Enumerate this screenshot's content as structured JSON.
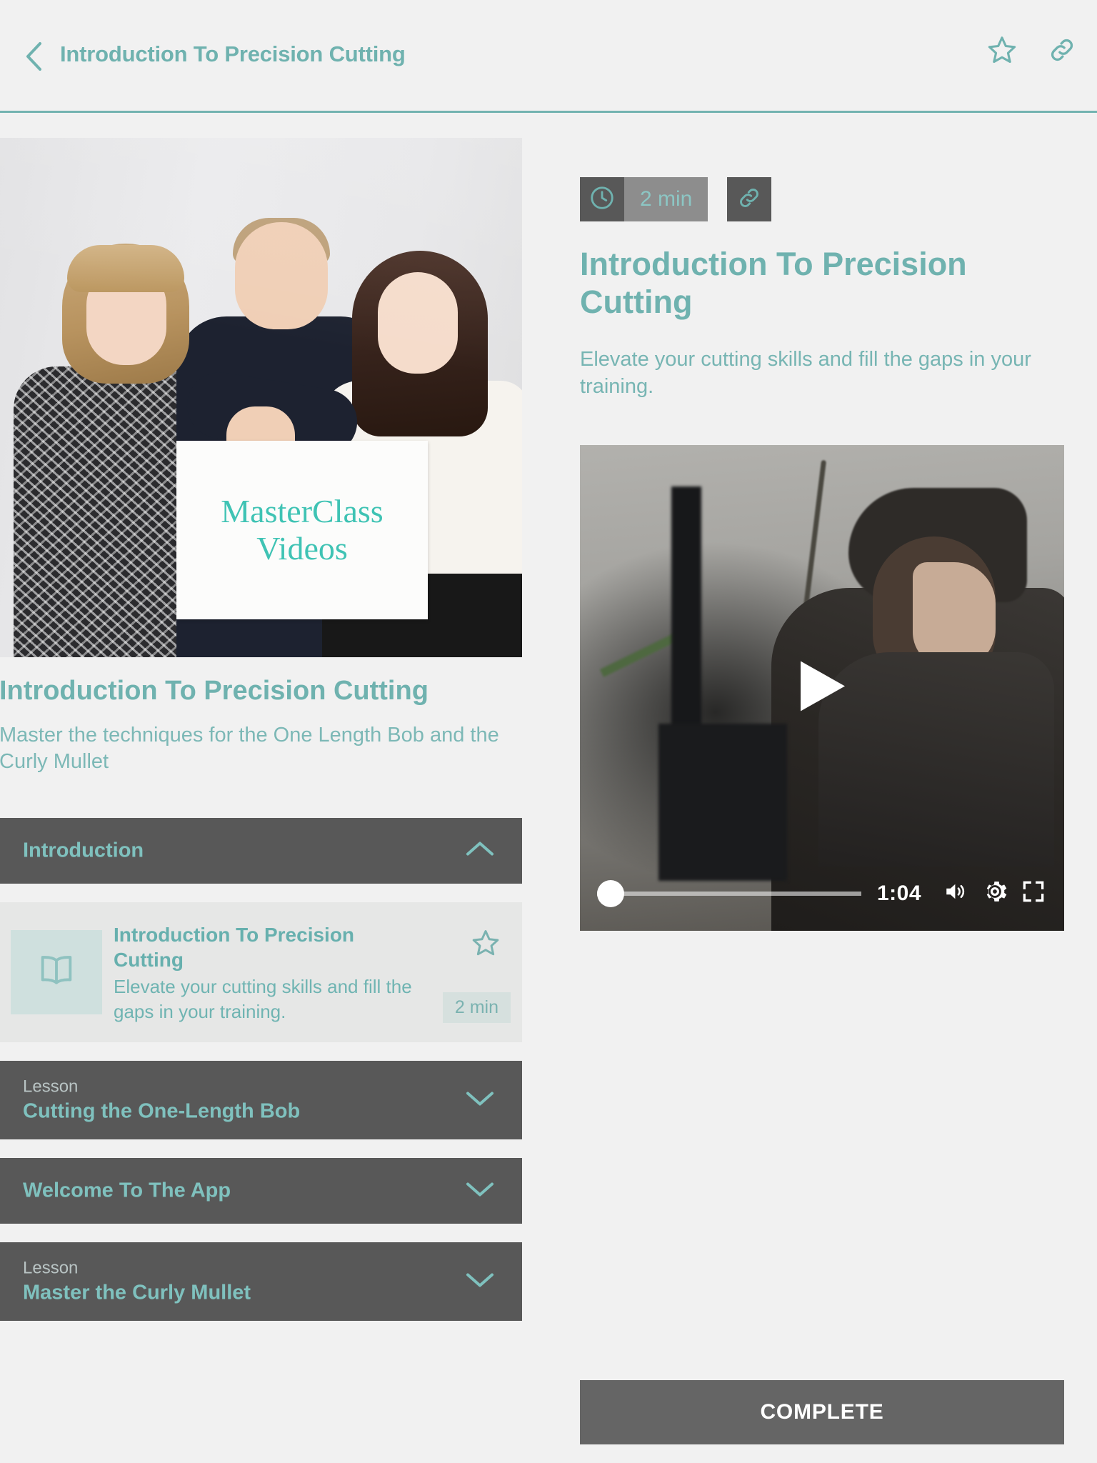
{
  "header": {
    "title": "Introduction To Precision Cutting",
    "back_icon": "chevron-left-icon",
    "favorite_icon": "star-outline-icon",
    "share_icon": "link-icon"
  },
  "colors": {
    "accent_teal": "#6fb2af",
    "accent_teal_light": "#7fc1be",
    "dark_panel": "#585858",
    "page_background": "#f1f1f1",
    "sign_teal": "#3fc3b4"
  },
  "hero": {
    "sign_line_1": "MasterClass",
    "sign_line_2": "Videos",
    "alt": "Three people holding a MasterClass Videos sign"
  },
  "course": {
    "title": "Introduction To Precision Cutting",
    "subtitle": "Master the techniques for the One Length Bob and the Curly Mullet"
  },
  "curriculum": [
    {
      "type": "section",
      "kicker": "",
      "label": "Introduction",
      "expanded": true,
      "chevron": "chevron-up-icon"
    },
    {
      "type": "section",
      "kicker": "Lesson",
      "label": "Cutting the One-Length Bob",
      "expanded": false,
      "chevron": "chevron-down-icon"
    },
    {
      "type": "section",
      "kicker": "",
      "label": "Welcome To The App",
      "expanded": false,
      "chevron": "chevron-down-icon"
    },
    {
      "type": "section",
      "kicker": "Lesson",
      "label": "Master the Curly Mullet",
      "expanded": false,
      "chevron": "chevron-down-icon"
    }
  ],
  "lesson_card": {
    "thumb_icon": "book-open-icon",
    "title": "Introduction To Precision Cutting",
    "description": "Elevate your cutting skills and fill the gaps in your training.",
    "duration": "2 min",
    "favorite_icon": "star-outline-icon"
  },
  "detail": {
    "clock_icon": "clock-icon",
    "duration": "2 min",
    "share_icon": "link-icon",
    "title": "Introduction To Precision Cutting",
    "description": "Elevate your cutting skills and fill the gaps in your training."
  },
  "video": {
    "play_icon": "play-icon",
    "time": "1:04",
    "volume_icon": "volume-up-icon",
    "settings_icon": "gear-icon",
    "fullscreen_icon": "fullscreen-icon",
    "progress_percent": 0
  },
  "footer": {
    "complete_label": "COMPLETE"
  }
}
